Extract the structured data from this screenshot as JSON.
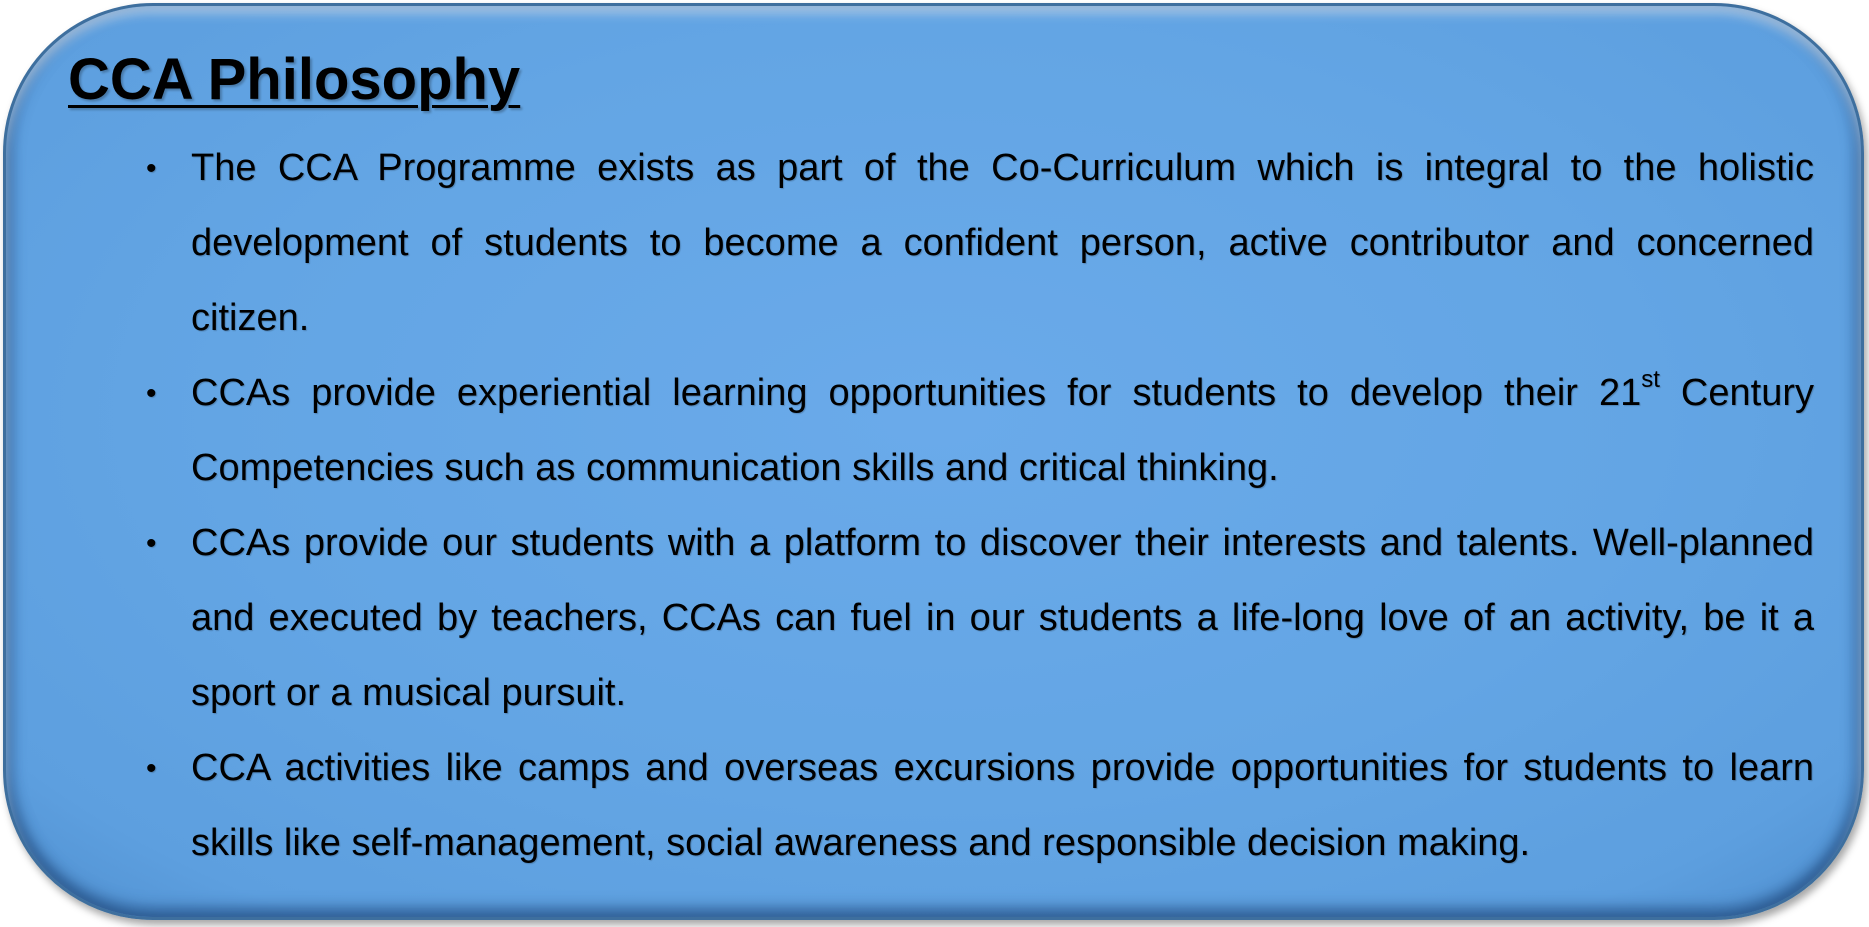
{
  "title": "CCA Philosophy",
  "bullet_glyph": "•",
  "bullets": [
    {
      "text": "The CCA Programme exists as part of the Co-Curriculum which is integral to the holistic development of students to become a confident person, active contributor and concerned citizen."
    },
    {
      "text_before": "CCAs provide experiential learning opportunities for students to develop their 21",
      "superscript": "st",
      "text_after": " Century Competencies such as communication skills and critical thinking."
    },
    {
      "text": "CCAs provide our students with a platform to discover their interests and talents. Well-planned and executed by teachers, CCAs can fuel in our students a life-long love of an activity, be it a sport or a musical pursuit."
    },
    {
      "text": "CCA activities like camps and overseas excursions provide opportunities for students to learn skills like self-management, social awareness and responsible decision making."
    }
  ],
  "colors": {
    "panel_fill": "#63a5e4",
    "panel_border": "#3e6f9e",
    "text": "#000000"
  },
  "icons": [
    "bullet-dot-icon"
  ]
}
